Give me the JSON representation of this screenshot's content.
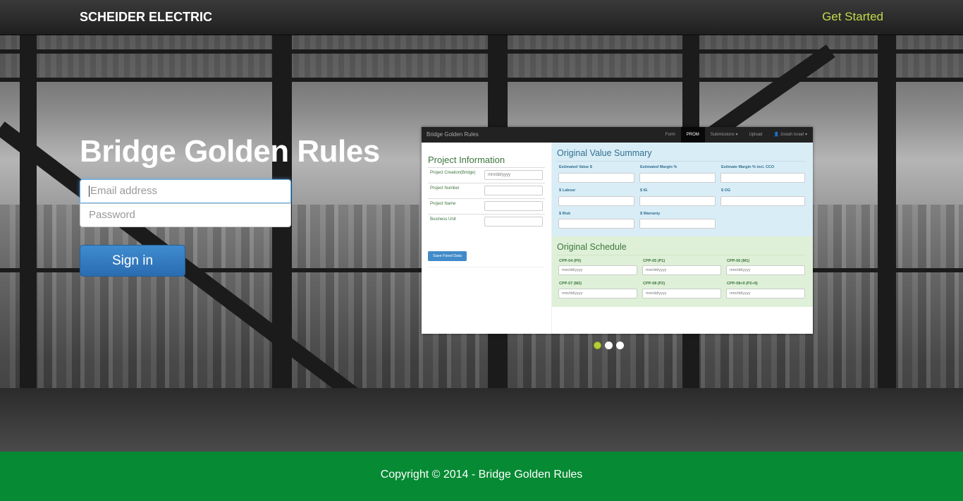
{
  "navbar": {
    "brand": "SCHEIDER ELECTRIC",
    "get_started": "Get Started"
  },
  "login": {
    "title": "Bridge Golden Rules",
    "email_placeholder": "Email address",
    "password_placeholder": "Password",
    "signin_label": "Sign in"
  },
  "preview": {
    "app_title": "Bridge Golden Rules",
    "menu": [
      "Form",
      "PROM",
      "Submissions ▾",
      "Upload",
      "👤 Josiah Israel ▾"
    ],
    "project_info": {
      "heading": "Project Information",
      "rows": [
        {
          "label": "Project Creation(Bridge)",
          "value": "mm/dd/yyyy"
        },
        {
          "label": "Project Number",
          "value": ""
        },
        {
          "label": "Project Name",
          "value": ""
        },
        {
          "label": "Business Unit",
          "value": ""
        }
      ],
      "save_button": "Save Fixed Data"
    },
    "value_summary": {
      "heading": "Original Value Summary",
      "fields": [
        "Estimated Value $",
        "Estimated Margin %",
        "Estimate Margin % incl. CCO",
        "$ Labour",
        "$ IG",
        "$ OG",
        "$ Risk",
        "$ Warranty"
      ]
    },
    "schedule": {
      "heading": "Original Schedule",
      "fields": [
        {
          "label": "CPP-04 (P0)",
          "value": "mm/dd/yyyy"
        },
        {
          "label": "CPP-05 (P1)",
          "value": "mm/dd/yyyy"
        },
        {
          "label": "CPP-06 (M1)",
          "value": "mm/dd/yyyy"
        },
        {
          "label": "CPP-07 (M2)",
          "value": "mm/dd/yyyy"
        },
        {
          "label": "CPP-08 (P2)",
          "value": "mm/dd/yyyy"
        },
        {
          "label": "CPP-08+9 (P2+9)",
          "value": "mm/dd/yyyy"
        }
      ]
    }
  },
  "carousel": {
    "active_index": 0,
    "count": 3,
    "accent_color": "#b7cf34"
  },
  "footer": {
    "copyright": "Copyright © 2014 - Bridge Golden Rules"
  },
  "colors": {
    "brand_green": "#068a33",
    "link_lime": "#c3d94a",
    "button_blue": "#2a6cb0"
  }
}
